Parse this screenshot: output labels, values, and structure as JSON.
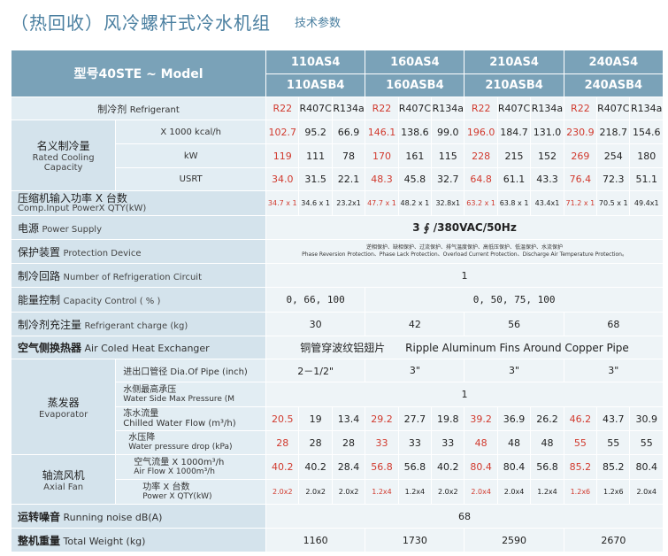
{
  "title": {
    "main": "（热回收）风冷螺杆式冷水机组",
    "sub": "技术参数"
  },
  "model_header": "型号40STE ~ Model",
  "models": [
    {
      "top": "110AS4",
      "bottom": "110ASB4"
    },
    {
      "top": "160AS4",
      "bottom": "160ASB4"
    },
    {
      "top": "210AS4",
      "bottom": "210ASB4"
    },
    {
      "top": "240AS4",
      "bottom": "240ASB4"
    }
  ],
  "refrigerant": {
    "label_cn": "制冷剂",
    "label_en": "Refrigerant",
    "types": [
      "R22",
      "R407C",
      "R134a"
    ]
  },
  "capacity": {
    "label_cn": "名义制冷量",
    "label_en1": "Rated Cooling",
    "label_en2": "Capacity",
    "rows": [
      {
        "unit": "X 1000 kcal/h",
        "values": [
          "102.7",
          "95.2",
          "66.9",
          "146.1",
          "138.6",
          "99.0",
          "196.0",
          "184.7",
          "131.0",
          "230.9",
          "218.7",
          "154.6"
        ]
      },
      {
        "unit": "kW",
        "values": [
          "119",
          "111",
          "78",
          "170",
          "161",
          "115",
          "228",
          "215",
          "152",
          "269",
          "254",
          "180"
        ]
      },
      {
        "unit": "USRT",
        "values": [
          "34.0",
          "31.5",
          "22.1",
          "48.3",
          "45.8",
          "32.7",
          "64.8",
          "61.1",
          "43.3",
          "76.4",
          "72.3",
          "51.1"
        ]
      }
    ]
  },
  "comp_input": {
    "label_cn": "压缩机输入功率 X 台数",
    "label_en": "Comp.Input PowerX QTY(kW)",
    "values": [
      "34.7 x 1",
      "34.6 x 1",
      "23.2x1",
      "47.7 x 1",
      "48.2 x 1",
      "32.8x1",
      "63.2 x 1",
      "63.8 x 1",
      "43.4x1",
      "71.2 x 1",
      "70.5 x 1",
      "49.4x1"
    ]
  },
  "power_supply": {
    "label_cn": "电源",
    "label_en": "Power Supply",
    "value": "3 ∮ /380VAC/50Hz"
  },
  "protection": {
    "label_cn": "保护装置",
    "label_en": "Protection Device",
    "value_cn": "逆相保护、缺相保护、过流保护、排气温度保护、高低压保护、低温保护、水流保护",
    "value_en": "Phase Reversion Protection、Phase Lack Protection、Overload Current Protection、Discharge Air Temperature Protection。"
  },
  "circuits": {
    "label_cn": "制冷回路",
    "label_en": "Number of Refrigeration Circuit",
    "value": "1"
  },
  "capacity_control": {
    "label_cn": "能量控制",
    "label_en": "Capacity Control ( % )",
    "values": [
      "0, 66, 100",
      "0, 50, 75, 100"
    ]
  },
  "charge": {
    "label_cn": "制冷剂充注量",
    "label_en": "Refrigerant charge (kg)",
    "values": [
      "30",
      "42",
      "56",
      "68"
    ]
  },
  "heat_exchanger": {
    "label_cn": "空气侧换热器",
    "label_en": "Air Coled Heat Exchanger",
    "value_cn": "铜管穿波纹铝翅片",
    "value_en": "Ripple Aluminum Fins Around Copper Pipe"
  },
  "evaporator": {
    "label_cn": "蒸发器",
    "label_en": "Evaporator",
    "pipe": {
      "label": "进出口管径 Dia.Of Pipe (inch)",
      "values": [
        "2－1/2\"",
        "3\"",
        "3\"",
        "3\""
      ]
    },
    "pressure": {
      "label_cn": "水侧最高承压",
      "label_en": "Water Side Max Pressure (M",
      "value": "1"
    },
    "flow": {
      "label_cn": "冻水流量",
      "label_en": "Chilled Water Flow (m³/h)",
      "values": [
        "20.5",
        "19",
        "13.4",
        "29.2",
        "27.7",
        "19.8",
        "39.2",
        "36.9",
        "26.2",
        "46.2",
        "43.7",
        "30.9"
      ]
    },
    "drop": {
      "label_cn": "水压降",
      "label_en": "Water pressure drop (kPa)",
      "values": [
        "28",
        "28",
        "28",
        "33",
        "33",
        "33",
        "48",
        "48",
        "48",
        "55",
        "55",
        "55"
      ]
    }
  },
  "fan": {
    "label_cn": "轴流风机",
    "label_en": "Axial Fan",
    "airflow": {
      "label_cn": "空气流量 X 1000m³/h",
      "label_en": "Air Flow X 1000m³/h",
      "values": [
        "40.2",
        "40.2",
        "28.4",
        "56.8",
        "56.8",
        "40.2",
        "80.4",
        "80.4",
        "56.8",
        "85.2",
        "85.2",
        "80.4"
      ]
    },
    "power": {
      "label_cn": "功率 X 台数",
      "label_en": "Power X QTY(kW)",
      "values": [
        "2.0x2",
        "2.0x2",
        "2.0x2",
        "1.2x4",
        "1.2x4",
        "2.0x2",
        "2.0x4",
        "2.0x4",
        "1.2x4",
        "1.2x6",
        "1.2x6",
        "2.0x4"
      ]
    }
  },
  "noise": {
    "label_cn": "运转噪音",
    "label_en": "Running noise dB(A)",
    "value": "68"
  },
  "weight": {
    "label_cn": "整机重量",
    "label_en": "Total Weight (kg)",
    "values": [
      "1160",
      "1730",
      "2590",
      "2670"
    ]
  }
}
